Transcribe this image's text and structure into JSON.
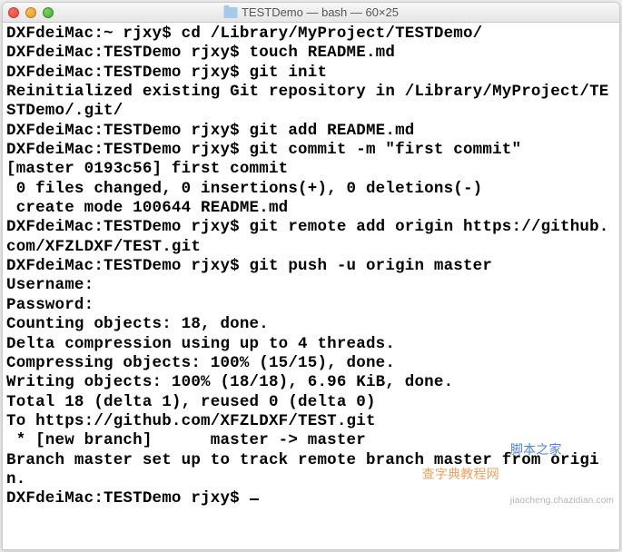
{
  "window": {
    "title": "TESTDemo — bash — 60×25"
  },
  "terminal": {
    "lines": [
      "DXFdeiMac:~ rjxy$ cd /Library/MyProject/TESTDemo/",
      "DXFdeiMac:TESTDemo rjxy$ touch README.md",
      "DXFdeiMac:TESTDemo rjxy$ git init",
      "Reinitialized existing Git repository in /Library/MyProject/TESTDemo/.git/",
      "DXFdeiMac:TESTDemo rjxy$ git add README.md",
      "DXFdeiMac:TESTDemo rjxy$ git commit -m \"first commit\"",
      "[master 0193c56] first commit",
      " 0 files changed, 0 insertions(+), 0 deletions(-)",
      " create mode 100644 README.md",
      "DXFdeiMac:TESTDemo rjxy$ git remote add origin https://github.com/XFZLDXF/TEST.git",
      "DXFdeiMac:TESTDemo rjxy$ git push -u origin master",
      "Username:",
      "Password:",
      "Counting objects: 18, done.",
      "Delta compression using up to 4 threads.",
      "Compressing objects: 100% (15/15), done.",
      "Writing objects: 100% (18/18), 6.96 KiB, done.",
      "Total 18 (delta 1), reused 0 (delta 0)",
      "To https://github.com/XFZLDXF/TEST.git",
      " * [new branch]      master -> master",
      "Branch master set up to track remote branch master from origin.",
      "DXFdeiMac:TESTDemo rjxy$ "
    ]
  },
  "watermarks": {
    "w1": "查字典教程网",
    "w2": "脚本之家",
    "w3": "jiaocheng.chazidian.com"
  }
}
